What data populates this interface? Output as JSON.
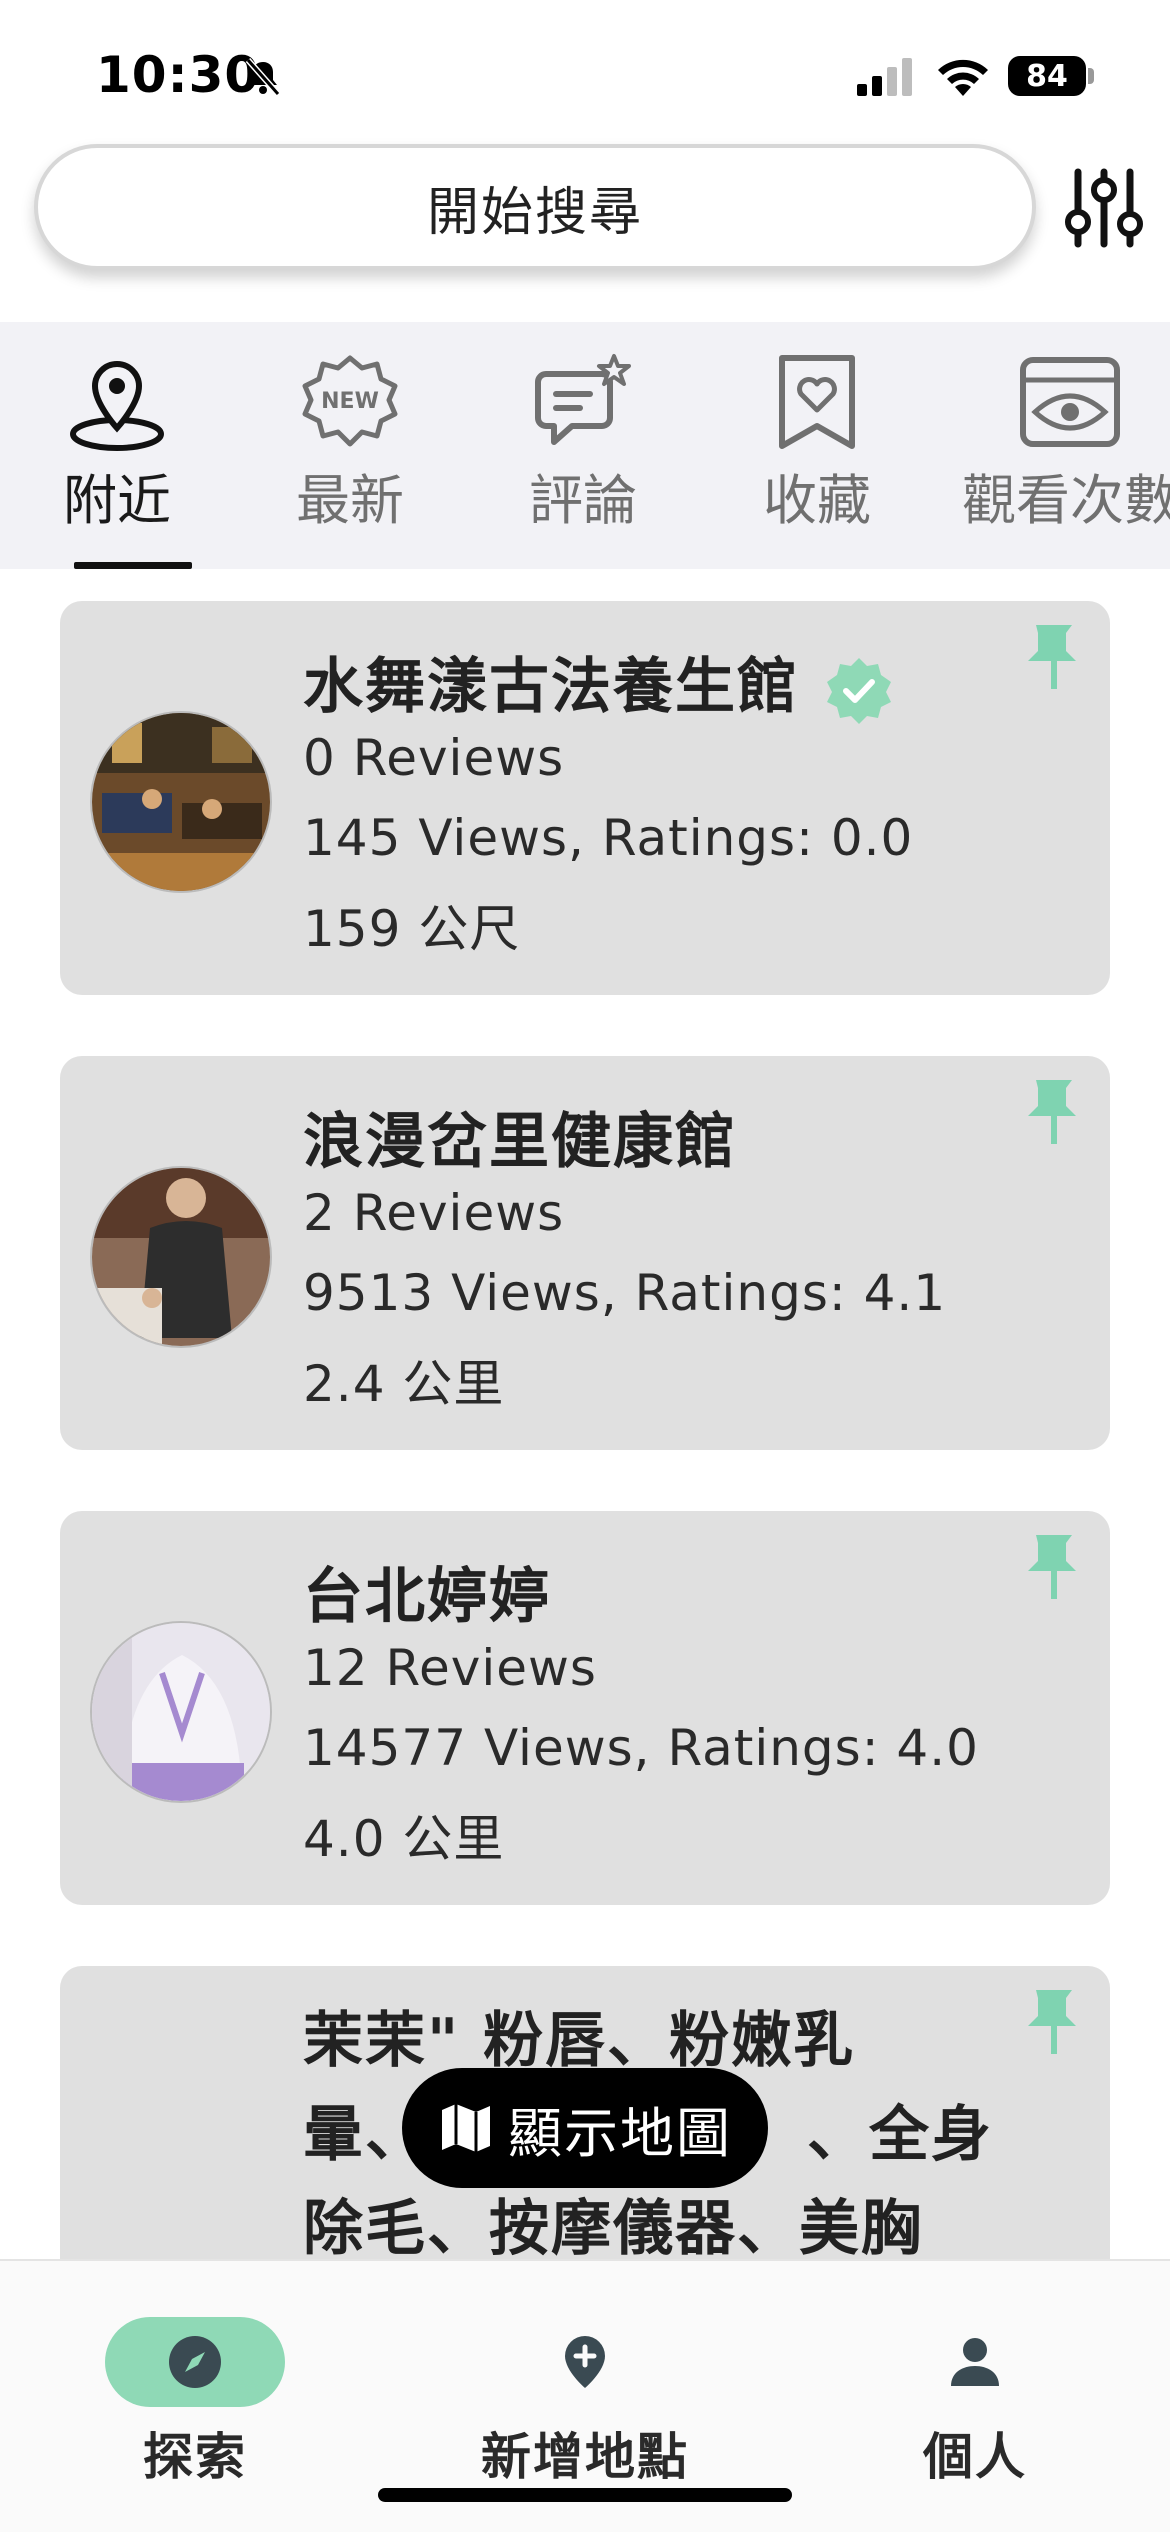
{
  "status_bar": {
    "time": "10:30",
    "battery": "84"
  },
  "search": {
    "placeholder": "開始搜尋"
  },
  "tabs": [
    {
      "label": "附近",
      "icon": "location-pin-icon",
      "active": true
    },
    {
      "label": "最新",
      "icon": "new-badge-icon"
    },
    {
      "label": "評論",
      "icon": "comment-star-icon"
    },
    {
      "label": "收藏",
      "icon": "bookmark-heart-icon"
    },
    {
      "label": "觀看次數",
      "icon": "eye-icon"
    }
  ],
  "places": [
    {
      "name": "水舞漾古法養生館",
      "verified": true,
      "reviews": "0 Reviews",
      "stats": "145 Views, Ratings: 0.0",
      "distance": "159 公尺"
    },
    {
      "name": "浪漫岔里健康館",
      "reviews": "2 Reviews",
      "stats": "9513 Views, Ratings: 4.1",
      "distance": "2.4 公里"
    },
    {
      "name": "台北婷婷",
      "reviews": "12 Reviews",
      "stats": "14577 Views, Ratings: 4.0",
      "distance": "4.0 公里"
    },
    {
      "name_line1": "茉茉\" 粉唇、粉嫩乳",
      "name_line2_left": "暈、",
      "name_line2_right": "、全身",
      "name_line3": "除毛、按摩儀器、美胸"
    }
  ],
  "map_button": {
    "label": "顯示地圖"
  },
  "bottom_nav": [
    {
      "label": "探索",
      "icon": "compass-icon",
      "active": true
    },
    {
      "label": "新增地點",
      "icon": "add-location-icon"
    },
    {
      "label": "個人",
      "icon": "person-icon"
    }
  ],
  "colors": {
    "accent": "#8fd9b6",
    "pin": "#7fd3b1",
    "card_bg": "#e0e0e0",
    "tab_bg": "#f2f2f6"
  }
}
